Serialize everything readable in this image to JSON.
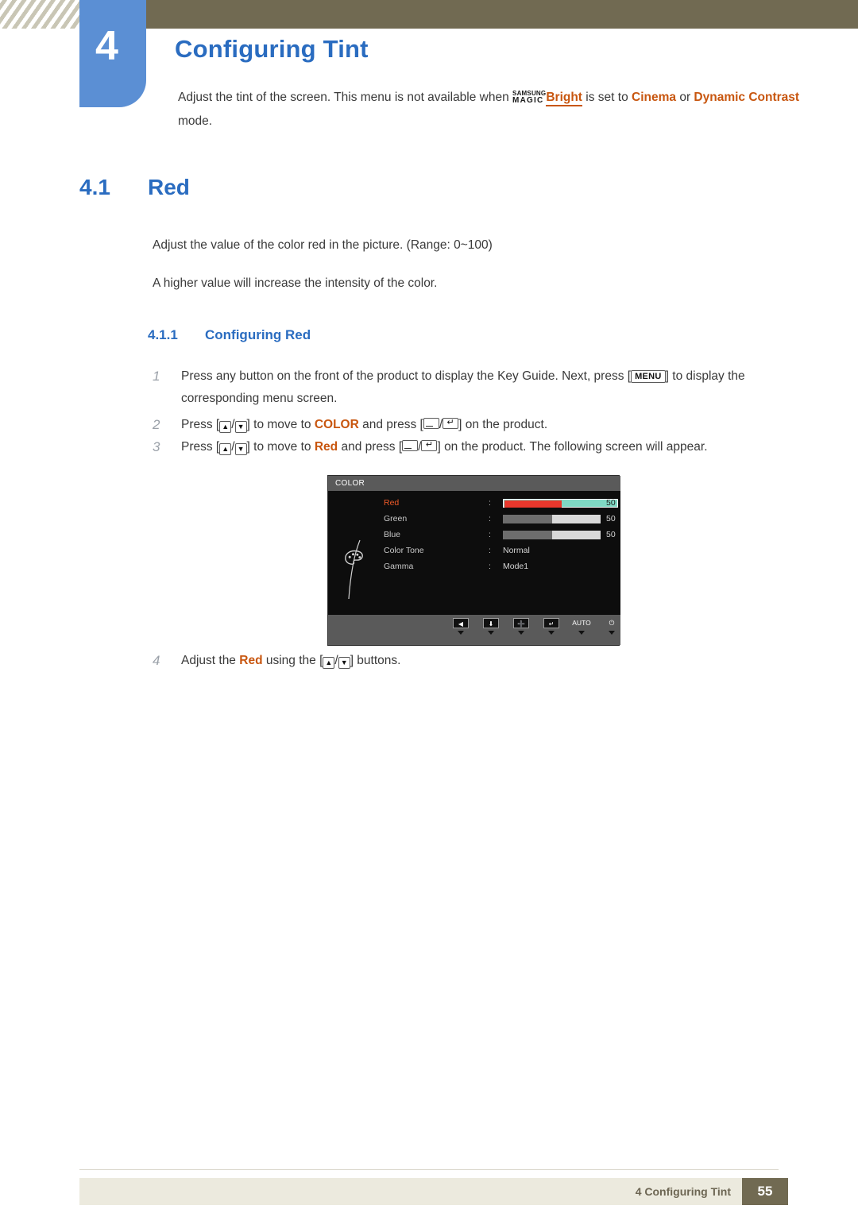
{
  "header": {
    "chapter_number": "4",
    "chapter_title": "Configuring Tint",
    "intro_part1": "Adjust the tint of the screen. This menu is not available when ",
    "magic_samsung": "SAMSUNG",
    "magic_magic": "MAGIC",
    "magic_bright": "Bright",
    "intro_part2": " is set to ",
    "intro_cinema": "Cinema",
    "intro_or": " or ",
    "intro_dynamic": "Dynamic Contrast",
    "intro_part3": " mode."
  },
  "section": {
    "number": "4.1",
    "title": "Red",
    "paragraph_1": "Adjust the value of the color red in the picture. (Range: 0~100)",
    "paragraph_2": "A higher value will increase the intensity of the color."
  },
  "subsection": {
    "number": "4.1.1",
    "title": "Configuring Red"
  },
  "steps": [
    {
      "index": "1",
      "text_a": "Press any button on the front of the product to display the Key Guide. Next, press [",
      "key": "MENU",
      "text_b": "] to display the corresponding menu screen."
    },
    {
      "index": "2",
      "text_a": "Press [",
      "text_b": "/",
      "text_c": "] to move to ",
      "target": "COLOR",
      "text_d": " and press [",
      "text_e": "/",
      "text_f": "] on the product."
    },
    {
      "index": "3",
      "text_a": "Press [",
      "text_b": "/",
      "text_c": "] to move to ",
      "target": "Red",
      "text_d": " and press [",
      "text_e": "/",
      "text_f": "] on the product. The following screen will appear."
    },
    {
      "index": "4",
      "text_a": "Adjust the ",
      "target": "Red",
      "text_b": " using the [",
      "text_c": "/",
      "text_d": "] buttons."
    }
  ],
  "osd": {
    "title": "COLOR",
    "icon": "palette-icon",
    "rows": [
      {
        "label": "Red",
        "colon": ":",
        "value": "50",
        "fill_percent": 50,
        "type": "slider",
        "active": true
      },
      {
        "label": "Green",
        "colon": ":",
        "value": "50",
        "fill_percent": 50,
        "type": "slider",
        "active": false
      },
      {
        "label": "Blue",
        "colon": ":",
        "value": "50",
        "fill_percent": 50,
        "type": "slider",
        "active": false
      },
      {
        "label": "Color Tone",
        "colon": ":",
        "value": "Normal",
        "type": "text",
        "active": false
      },
      {
        "label": "Gamma",
        "colon": ":",
        "value": "Mode1",
        "type": "text",
        "active": false
      }
    ],
    "buttons": [
      {
        "name": "back-button",
        "glyph": "◀"
      },
      {
        "name": "down-button",
        "glyph": "⬇"
      },
      {
        "name": "adjust-button",
        "glyph": "➕"
      },
      {
        "name": "enter-button",
        "glyph": "↵"
      },
      {
        "name": "auto-button",
        "glyph": "AUTO"
      },
      {
        "name": "power-button",
        "glyph": "⏻"
      }
    ]
  },
  "footer": {
    "text": "4 Configuring Tint",
    "page": "55"
  },
  "colors": {
    "accent_blue": "#2a6cc0",
    "accent_orange": "#c8560f",
    "header_olive": "#716a52",
    "badge_blue": "#5b8fd4",
    "slider_red": "#e8372c",
    "slider_active_bg": "#7fd9c4"
  }
}
